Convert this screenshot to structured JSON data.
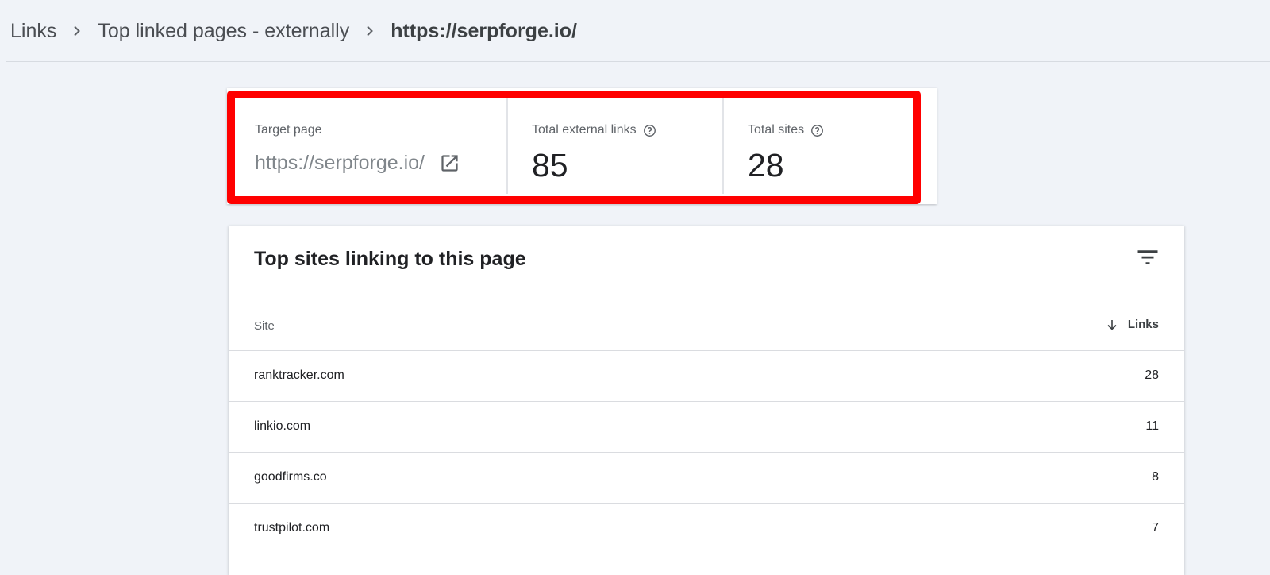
{
  "breadcrumb": {
    "items": [
      "Links",
      "Top linked pages - externally",
      "https://serpforge.io/"
    ]
  },
  "summary": {
    "target_label": "Target page",
    "target_url": "https://serpforge.io/",
    "external_links_label": "Total external links",
    "external_links_value": "85",
    "sites_label": "Total sites",
    "sites_value": "28",
    "highlight_color": "#ff0000"
  },
  "table": {
    "title": "Top sites linking to this page",
    "columns": {
      "site": "Site",
      "links": "Links"
    },
    "sort": "descending by Links",
    "rows": [
      {
        "site": "ranktracker.com",
        "links": "28"
      },
      {
        "site": "linkio.com",
        "links": "11"
      },
      {
        "site": "goodfirms.co",
        "links": "8"
      },
      {
        "site": "trustpilot.com",
        "links": "7"
      }
    ]
  },
  "icons": {
    "breadcrumb_separator": "chevron-right-icon",
    "open_link": "open-in-new-icon",
    "help": "help-outline-icon",
    "filter": "filter-list-icon",
    "sort": "arrow-down-icon"
  }
}
